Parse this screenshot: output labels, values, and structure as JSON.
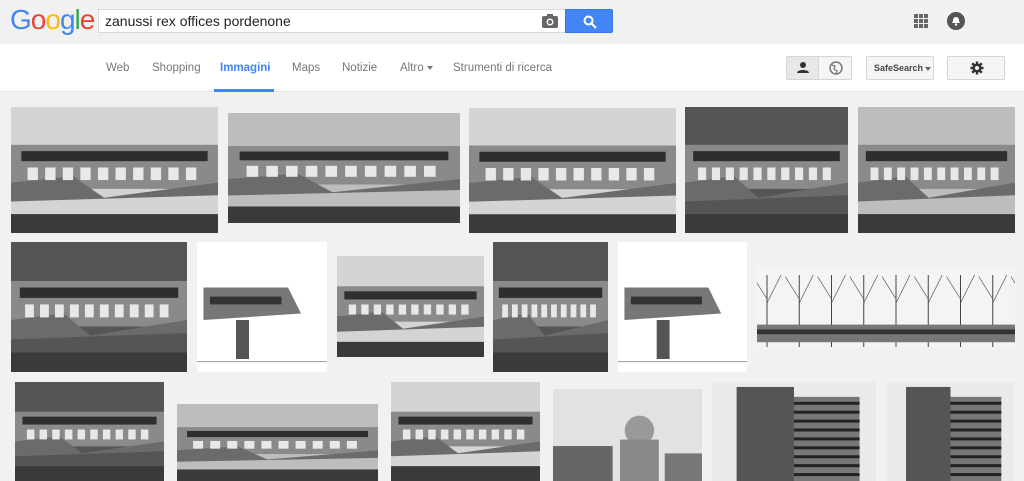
{
  "logo": {
    "letters": [
      "G",
      "o",
      "o",
      "g",
      "l",
      "e"
    ],
    "colors": [
      "#4285f4",
      "#ea4335",
      "#fbbc05",
      "#4285f4",
      "#34a853",
      "#ea4335"
    ]
  },
  "search": {
    "query": "zanussi rex offices pordenone"
  },
  "tabs": [
    {
      "label": "Web"
    },
    {
      "label": "Shopping"
    },
    {
      "label": "Immagini"
    },
    {
      "label": "Maps"
    },
    {
      "label": "Notizie"
    },
    {
      "label": "Altro"
    },
    {
      "label": "Strumenti di ricerca"
    }
  ],
  "active_tab": "Immagini",
  "safesearch": {
    "label": "SafeSearch"
  },
  "colors": {
    "accent": "#4285f4",
    "background": "#f1f1f1"
  },
  "icons": [
    "camera-icon",
    "search-icon",
    "apps-grid-icon",
    "notifications-icon",
    "person-icon",
    "globe-icon",
    "gear-icon"
  ],
  "image_results": [
    {
      "style": "bldg-sky"
    },
    {
      "style": "bldg-wide"
    },
    {
      "style": "bldg-sky"
    },
    {
      "style": "bldg-dark"
    },
    {
      "style": "bldg-wide"
    },
    {
      "style": "bldg-dark"
    },
    {
      "style": "sketch"
    },
    {
      "style": "bldg-sky"
    },
    {
      "style": "bldg-dark"
    },
    {
      "style": "sketch"
    },
    {
      "style": "trees"
    },
    {
      "style": "bldg-dark"
    },
    {
      "style": "bldg-wide"
    },
    {
      "style": "bldg-sky"
    },
    {
      "style": "city"
    },
    {
      "style": "tower"
    },
    {
      "style": "tower"
    }
  ]
}
